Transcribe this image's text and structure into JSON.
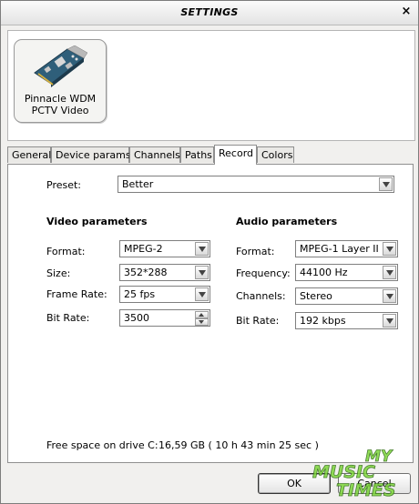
{
  "window": {
    "title": "SETTINGS",
    "close_glyph": "×"
  },
  "device": {
    "name_line1": "Pinnacle WDM",
    "name_line2": "PCTV Video",
    "icon": "capture-card-icon"
  },
  "tabs": [
    {
      "label": "General"
    },
    {
      "label": "Device params"
    },
    {
      "label": "Channels"
    },
    {
      "label": "Paths"
    },
    {
      "label": "Record",
      "active": true
    },
    {
      "label": "Colors"
    }
  ],
  "record": {
    "preset_label": "Preset:",
    "preset_value": "Better",
    "video": {
      "title": "Video parameters",
      "format_label": "Format:",
      "format_value": "MPEG-2",
      "size_label": "Size:",
      "size_value": "352*288",
      "framerate_label": "Frame Rate:",
      "framerate_value": "25 fps",
      "bitrate_label": "Bit Rate:",
      "bitrate_value": "3500"
    },
    "audio": {
      "title": "Audio parameters",
      "format_label": "Format:",
      "format_value": "MPEG-1 Layer II",
      "frequency_label": "Frequency:",
      "frequency_value": "44100 Hz",
      "channels_label": "Channels:",
      "channels_value": "Stereo",
      "bitrate_label": "Bit Rate:",
      "bitrate_value": "192 kbps"
    },
    "free_space_label": "Free space on drive C:",
    "free_space_value": "16,59 GB ( 10 h 43 min 25 sec )"
  },
  "buttons": {
    "ok": "OK",
    "cancel": "Cancel"
  },
  "watermark": {
    "line1": "MY",
    "line2": "MUSIC",
    "line3": "TIMES"
  },
  "colors": {
    "watermark_green": "#7dd63a",
    "tab_active": "#ffffff"
  }
}
